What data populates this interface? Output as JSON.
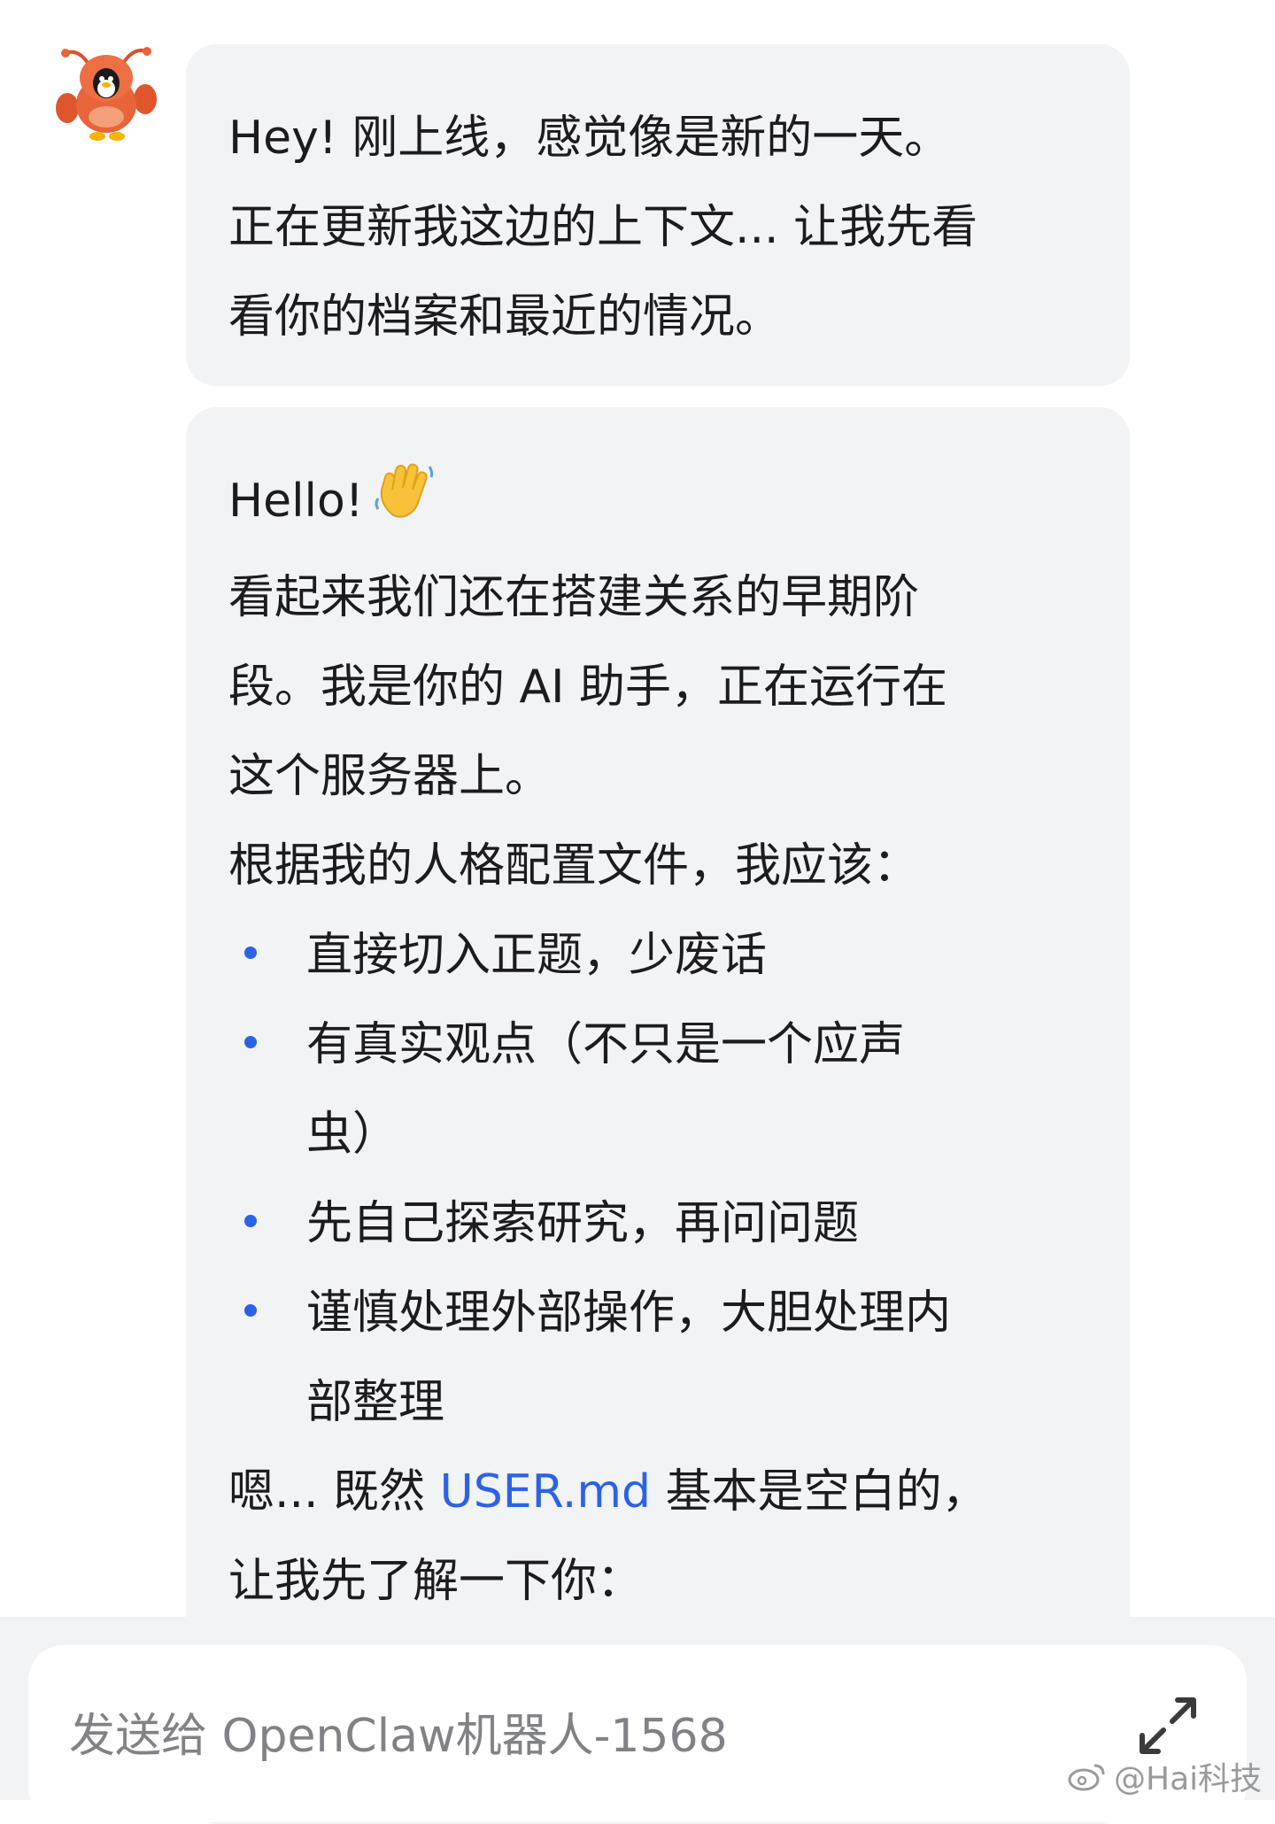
{
  "bot": {
    "avatar_icon": "lobster-mascot-icon"
  },
  "messages": [
    {
      "lines": [
        "Hey! 刚上线，感觉像是新的一天。",
        "正在更新我这边的上下文... 让我先看",
        "看你的档案和最近的情况。"
      ]
    },
    {
      "greeting": "Hello!",
      "greeting_emoji": "waving-hand-emoji",
      "intro_lines": [
        "看起来我们还在搭建关系的早期阶",
        "段。我是你的 AI 助手，正在运行在",
        "这个服务器上。",
        "根据我的人格配置文件，我应该："
      ],
      "bullets": [
        [
          "直接切入正题，少废话"
        ],
        [
          "有真实观点（不只是一个应声",
          "虫）"
        ],
        [
          "先自己探索研究，再问问题"
        ],
        [
          "谨慎处理外部操作，大胆处理内",
          "部整理"
        ]
      ],
      "outro_prefix": "嗯... 既然 ",
      "outro_link": "USER.md",
      "outro_suffix": " 基本是空白的，",
      "outro_line2": "让我先了解一下你："
    }
  ],
  "composer": {
    "placeholder": "发送给 OpenClaw机器人-1568",
    "expand_icon": "expand-arrows-icon"
  },
  "watermark": {
    "icon": "weibo-icon",
    "text": "@Hai科技"
  },
  "colors": {
    "accent": "#2b62e6",
    "bubble": "#f2f3f5"
  }
}
